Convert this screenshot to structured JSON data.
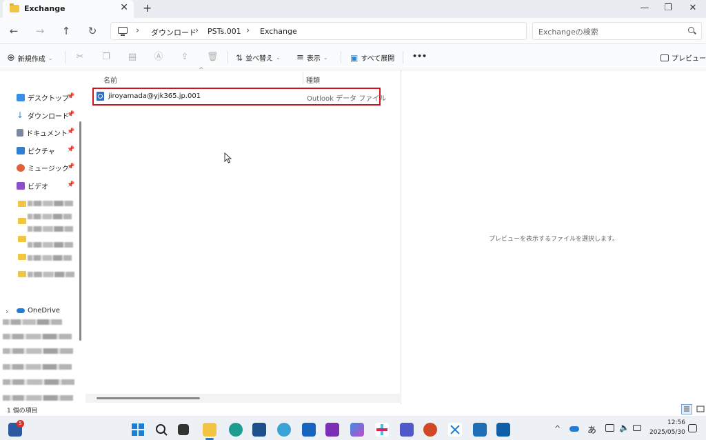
{
  "window": {
    "tab_title": "Exchange",
    "new_tab": "+",
    "close_tab": "✕",
    "controls": {
      "minimize": "—",
      "maximize": "❐",
      "close": "✕"
    }
  },
  "navigation": {
    "back": "←",
    "forward": "→",
    "up": "↑",
    "refresh": "↻",
    "breadcrumb": [
      "ダウンロード",
      "PSTs.001",
      "Exchange"
    ],
    "search_placeholder": "Exchangeの検索"
  },
  "commands": {
    "new": "新規作成",
    "sort": "並べ替え",
    "view": "表示",
    "expand_all": "すべて展開",
    "more": "•••",
    "preview": "プレビュー"
  },
  "sidebar": {
    "quick_access": [
      {
        "label": "デスクトップ",
        "color": "#3a8ee6"
      },
      {
        "label": "ダウンロード",
        "color": "#2b87d8"
      },
      {
        "label": "ドキュメント",
        "color": "#7a8aa3"
      },
      {
        "label": "ピクチャ",
        "color": "#2f7fd6"
      },
      {
        "label": "ミュージック",
        "color": "#e0623a"
      },
      {
        "label": "ビデオ",
        "color": "#8b4fc9"
      }
    ],
    "onedrive": "OneDrive",
    "expand_chevron": "›",
    "pin_glyph": "📌"
  },
  "file_list": {
    "columns": {
      "name": "名前",
      "type": "種類"
    },
    "files": [
      {
        "name": "jiroyamada@yjk365.jp.001",
        "type": "Outlook データ ファイル"
      }
    ]
  },
  "preview": {
    "message": "プレビューを表示するファイルを選択します。"
  },
  "status": {
    "item_count": "1 個の項目"
  },
  "taskbar": {
    "notification_badge": "5",
    "ime_mode": "あ",
    "time": "12:56",
    "date": "2025/05/30"
  }
}
